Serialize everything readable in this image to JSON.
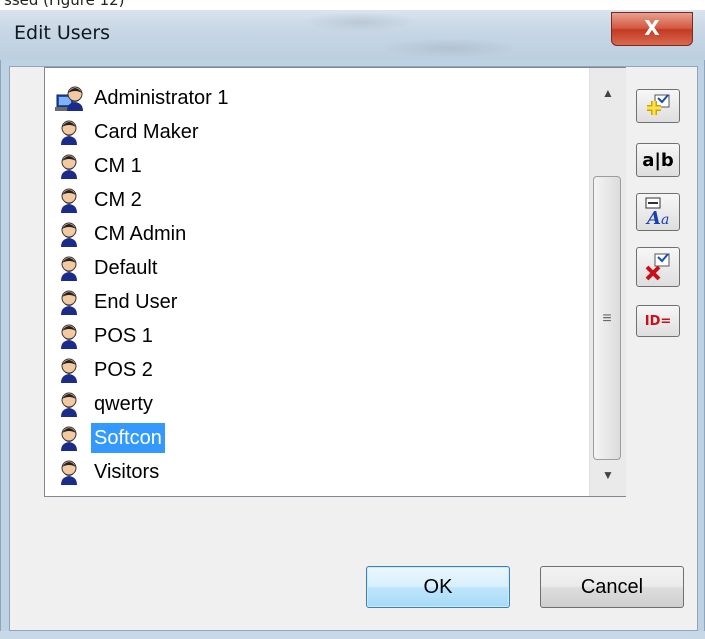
{
  "caption_fragment": "ssed (Figure 12)",
  "dialog": {
    "title": "Edit Users",
    "close_label": "X"
  },
  "users": [
    {
      "name": "Administrator 1",
      "icon": "admin-user-icon",
      "selected": false
    },
    {
      "name": "Card Maker",
      "icon": "user-icon",
      "selected": false
    },
    {
      "name": "CM 1",
      "icon": "user-icon",
      "selected": false
    },
    {
      "name": "CM 2",
      "icon": "user-icon",
      "selected": false
    },
    {
      "name": "CM Admin",
      "icon": "user-icon",
      "selected": false
    },
    {
      "name": "Default",
      "icon": "user-icon",
      "selected": false
    },
    {
      "name": "End User",
      "icon": "user-icon",
      "selected": false
    },
    {
      "name": "POS 1",
      "icon": "user-icon",
      "selected": false
    },
    {
      "name": "POS 2",
      "icon": "user-icon",
      "selected": false
    },
    {
      "name": "qwerty",
      "icon": "user-icon",
      "selected": false
    },
    {
      "name": "Softcon",
      "icon": "user-icon",
      "selected": true
    },
    {
      "name": "Visitors",
      "icon": "user-icon",
      "selected": false
    }
  ],
  "toolbar": {
    "add_icon": "add-user-icon",
    "rename_label": "a|b",
    "properties_icon": "properties-icon",
    "delete_icon": "delete-user-icon",
    "id_label": "ID="
  },
  "buttons": {
    "ok": "OK",
    "cancel": "Cancel"
  },
  "colors": {
    "selection": "#3399ff",
    "close_button": "#c23a22",
    "titlebar": "#c7d6e4"
  }
}
